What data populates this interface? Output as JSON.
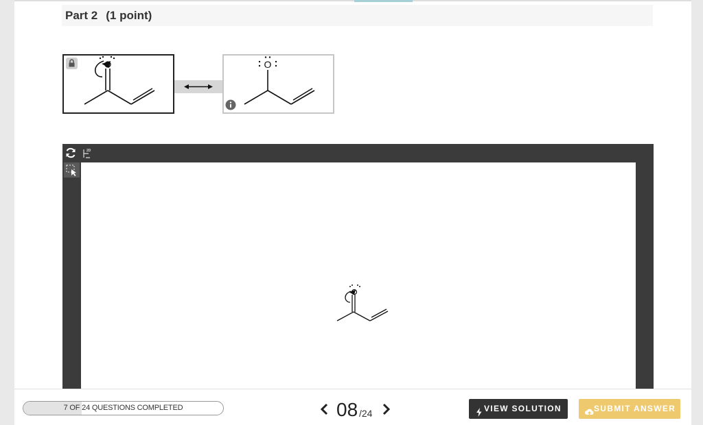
{
  "part": {
    "title": "Part 2",
    "points": "(1 point)"
  },
  "structures": {
    "left_atom": "O",
    "right_atom": "O"
  },
  "sketcher": {
    "tools": [
      "refresh-icon",
      "2d-clean-icon",
      "select-tool-icon"
    ]
  },
  "footer": {
    "progress": {
      "text": "7 OF 24 QUESTIONS COMPLETED",
      "completed": 7,
      "total": 24
    },
    "pager": {
      "current": "08",
      "total": "/24"
    },
    "view_solution_label": "VIEW SOLUTION",
    "submit_answer_label": "SUBMIT ANSWER"
  },
  "colors": {
    "submit_button": "#eec96e",
    "view_solution_button": "#333333",
    "sketcher_frame": "#3b3b3b"
  }
}
